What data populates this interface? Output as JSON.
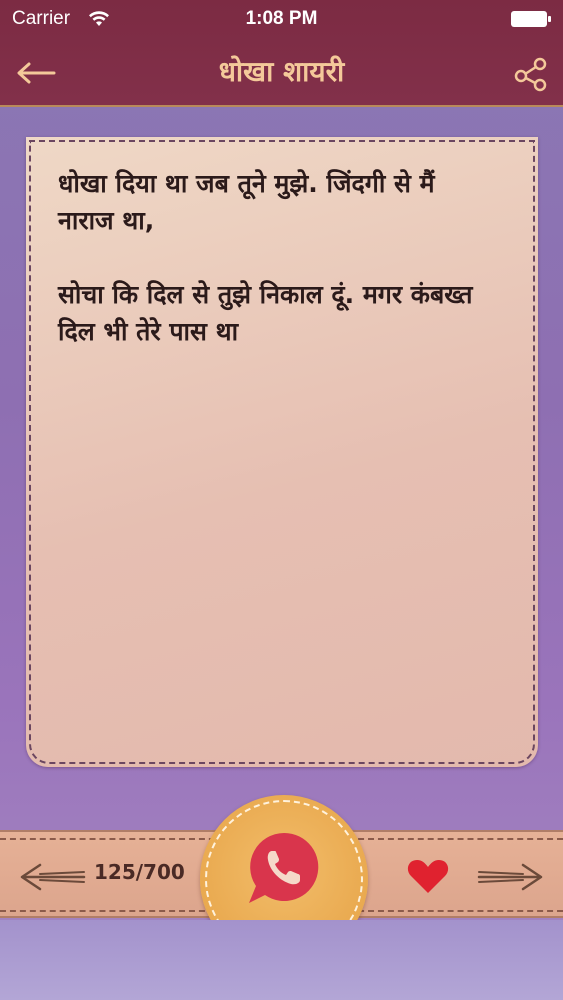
{
  "status_bar": {
    "carrier": "Carrier",
    "time": "1:08 PM"
  },
  "nav": {
    "title": "धोखा शायरी",
    "back_icon": "arrow-left-icon",
    "share_icon": "share-icon"
  },
  "card": {
    "lines": [
      "धोखा दिया था जब तूने मुझे. जिंदगी से मैं नाराज था,",
      "सोचा कि दिल से तुझे निकाल दूं. मगर कंबख्त दिल भी तेरे पास था"
    ]
  },
  "bottom": {
    "counter": "125/700",
    "prev_icon": "arrow-left-icon",
    "next_icon": "arrow-right-icon",
    "whatsapp_icon": "whatsapp-icon",
    "heart_icon": "heart-icon"
  },
  "colors": {
    "nav_bar": "#7c2b43",
    "title_text": "#f4c99a",
    "heart": "#e0222f",
    "whatsapp": "#d9354c",
    "card": "#e8c7b8"
  }
}
